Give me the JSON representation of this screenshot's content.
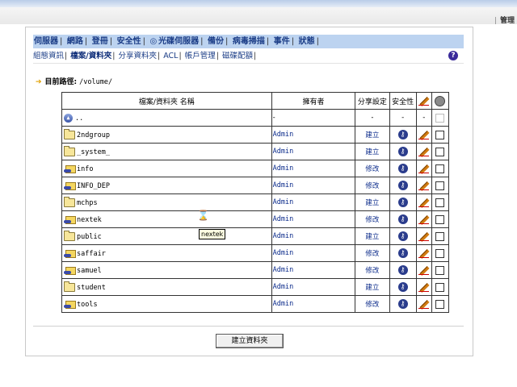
{
  "header": {
    "top_link": "管理",
    "top_link_sep": "|"
  },
  "menu1": {
    "items": [
      "伺服器",
      "網路",
      "登冊",
      "安全性",
      "光碟伺服器",
      "備份",
      "病毒掃描",
      "事件",
      "狀態"
    ]
  },
  "menu2": {
    "items": [
      "組態資訊",
      "檔案/資料夾",
      "分享資料夾",
      "ACL",
      "帳戶管理",
      "磁碟配額"
    ],
    "active_index": 1
  },
  "path": {
    "label": "目前路徑:",
    "value": "/volume/"
  },
  "table": {
    "headers": {
      "name": "檔案/資料夾 名稱",
      "owner": "擁有者",
      "share": "分享設定",
      "security": "安全性"
    },
    "parent_row": {
      "name": "..",
      "owner": "-",
      "share": "-",
      "security": "-",
      "edit": "-"
    },
    "rows": [
      {
        "name": "2ndgroup",
        "owner": "Admin",
        "share": "建立",
        "shared": false
      },
      {
        "name": "_system_",
        "owner": "Admin",
        "share": "建立",
        "shared": false
      },
      {
        "name": "info",
        "owner": "Admin",
        "share": "修改",
        "shared": true
      },
      {
        "name": "INFO_DEP",
        "owner": "Admin",
        "share": "修改",
        "shared": true
      },
      {
        "name": "mchps",
        "owner": "Admin",
        "share": "建立",
        "shared": false
      },
      {
        "name": "nextek",
        "owner": "Admin",
        "share": "修改",
        "shared": true
      },
      {
        "name": "public",
        "owner": "Admin",
        "share": "建立",
        "shared": false
      },
      {
        "name": "saffair",
        "owner": "Admin",
        "share": "修改",
        "shared": true
      },
      {
        "name": "samuel",
        "owner": "Admin",
        "share": "修改",
        "shared": true
      },
      {
        "name": "student",
        "owner": "Admin",
        "share": "建立",
        "shared": false
      },
      {
        "name": "tools",
        "owner": "Admin",
        "share": "修改",
        "shared": true
      }
    ]
  },
  "create_button": "建立資料夾",
  "tooltip": "nextek",
  "colors": {
    "menu_bg": "#bcd3f0",
    "link": "#1a3c86"
  }
}
